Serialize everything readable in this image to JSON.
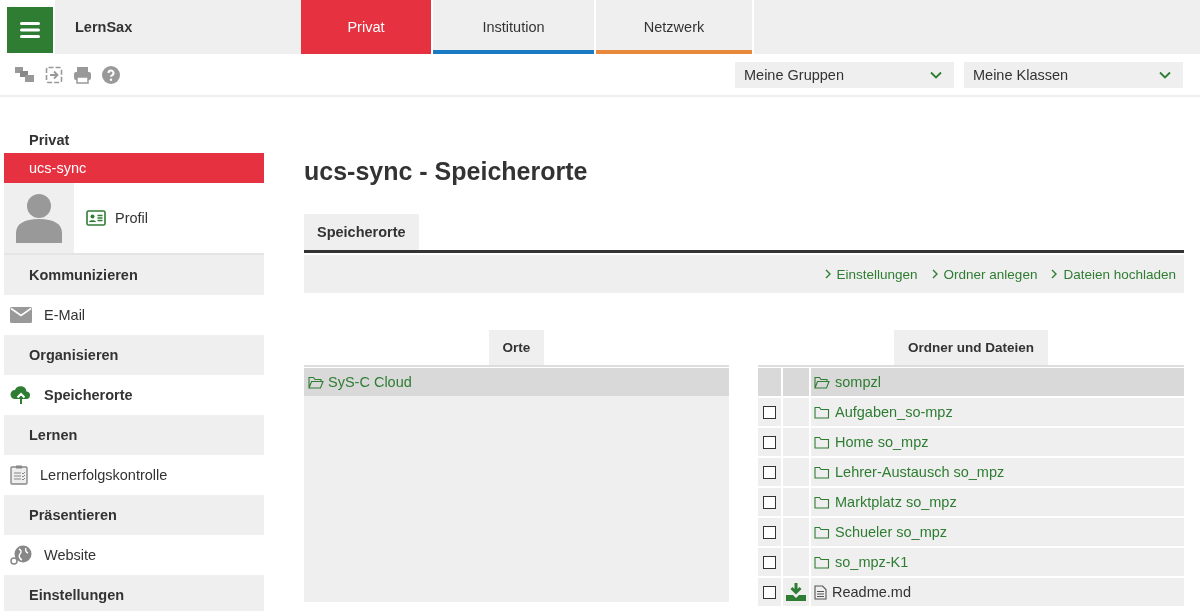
{
  "header": {
    "app_name": "LernSax",
    "tabs": [
      {
        "label": "Privat",
        "selected": true,
        "color": "#e63140"
      },
      {
        "label": "Institution",
        "selected": false,
        "color": "#1a7ac4"
      },
      {
        "label": "Netzwerk",
        "selected": false,
        "color": "#e8883a"
      }
    ],
    "selects": [
      {
        "value": "Meine Gruppen"
      },
      {
        "value": "Meine Klassen"
      }
    ]
  },
  "sidebar": {
    "title": "Privat",
    "current": "ucs-sync",
    "profile_link": "Profil",
    "sections": [
      {
        "heading": "Kommunizieren",
        "items": [
          {
            "label": "E-Mail",
            "selected": false
          }
        ]
      },
      {
        "heading": "Organisieren",
        "items": [
          {
            "label": "Speicherorte",
            "selected": true
          }
        ]
      },
      {
        "heading": "Lernen",
        "items": [
          {
            "label": "Lernerfolgskontrolle",
            "selected": false
          }
        ]
      },
      {
        "heading": "Präsentieren",
        "items": [
          {
            "label": "Website",
            "selected": false
          }
        ]
      },
      {
        "heading": "Einstellungen"
      }
    ]
  },
  "main": {
    "title": "ucs-sync - Speicherorte",
    "tab": "Speicherorte",
    "actions": [
      "Einstellungen",
      "Ordner anlegen",
      "Dateien hochladen"
    ],
    "locations": {
      "heading": "Orte",
      "items": [
        {
          "name": "SyS-C Cloud",
          "selected": true
        }
      ]
    },
    "files": {
      "heading": "Ordner und Dateien",
      "items": [
        {
          "name": "sompzl",
          "kind": "parent",
          "selected": true
        },
        {
          "name": "Aufgaben_so-mpz",
          "kind": "folder",
          "checked": false,
          "selected": false
        },
        {
          "name": "Home so_mpz",
          "kind": "folder",
          "checked": false,
          "selected": false
        },
        {
          "name": "Lehrer-Austausch so_mpz",
          "kind": "folder",
          "checked": false,
          "selected": false
        },
        {
          "name": "Marktplatz so_mpz",
          "kind": "folder",
          "checked": false,
          "selected": false
        },
        {
          "name": "Schueler so_mpz",
          "kind": "folder",
          "checked": false,
          "selected": false
        },
        {
          "name": "so_mpz-K1",
          "kind": "folder",
          "checked": false,
          "selected": false
        },
        {
          "name": "Readme.md",
          "kind": "file",
          "checked": false,
          "selected": false
        }
      ]
    }
  }
}
